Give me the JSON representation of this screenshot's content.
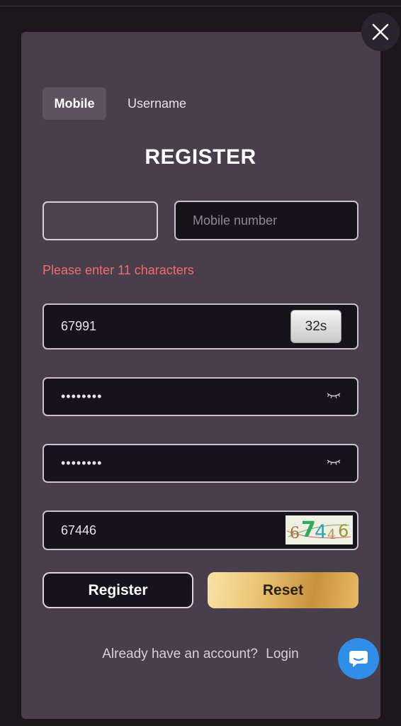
{
  "tabs": [
    {
      "label": "Mobile",
      "active": true
    },
    {
      "label": "Username",
      "active": false
    }
  ],
  "title": "REGISTER",
  "country_code": {
    "value": ""
  },
  "mobile": {
    "placeholder": "Mobile number",
    "value": ""
  },
  "error_message": "Please enter 11 characters",
  "verification": {
    "value": "67991",
    "countdown": "32s"
  },
  "password": {
    "masked": "••••••••"
  },
  "confirm_password": {
    "masked": "••••••••"
  },
  "captcha": {
    "value": "67446",
    "image_text": "67446"
  },
  "buttons": {
    "register": "Register",
    "reset": "Reset"
  },
  "footer": {
    "text": "Already have an account?",
    "login": "Login"
  },
  "colors": {
    "accent_gold": "#e9c373",
    "error": "#ec6d6d",
    "chat": "#2f8fe8"
  }
}
